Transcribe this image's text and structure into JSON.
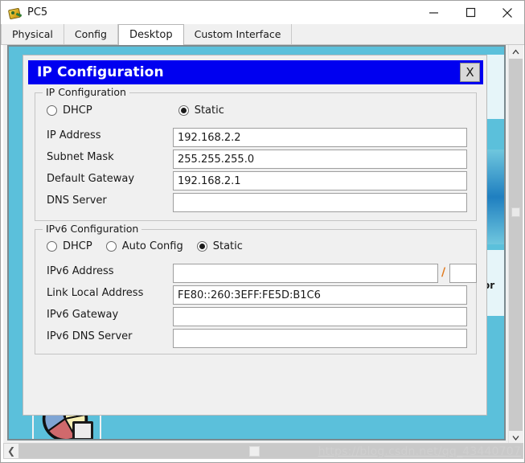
{
  "window": {
    "title": "PC5",
    "icon": "packet-tracer-device-icon",
    "controls": {
      "minimize": "–",
      "maximize": "□",
      "close": "✕"
    }
  },
  "tabs": [
    {
      "label": "Physical",
      "active": false
    },
    {
      "label": "Config",
      "active": false
    },
    {
      "label": "Desktop",
      "active": true
    },
    {
      "label": "Custom Interface",
      "active": false
    }
  ],
  "dialog": {
    "title": "IP Configuration",
    "close_label": "X",
    "ipv4": {
      "legend": "IP Configuration",
      "modes": [
        {
          "label": "DHCP",
          "selected": false
        },
        {
          "label": "Static",
          "selected": true
        }
      ],
      "fields": [
        {
          "label": "IP Address",
          "value": "192.168.2.2"
        },
        {
          "label": "Subnet Mask",
          "value": "255.255.255.0"
        },
        {
          "label": "Default Gateway",
          "value": "192.168.2.1"
        },
        {
          "label": "DNS Server",
          "value": ""
        }
      ]
    },
    "ipv6": {
      "legend": "IPv6 Configuration",
      "modes": [
        {
          "label": "DHCP",
          "selected": false
        },
        {
          "label": "Auto Config",
          "selected": false
        },
        {
          "label": "Static",
          "selected": true
        }
      ],
      "address": {
        "label": "IPv6 Address",
        "value": "",
        "separator": "/",
        "prefix": ""
      },
      "fields": [
        {
          "label": "Link Local Address",
          "value": "FE80::260:3EFF:FE5D:B1C6"
        },
        {
          "label": "IPv6 Gateway",
          "value": ""
        },
        {
          "label": "IPv6 DNS Server",
          "value": ""
        }
      ]
    }
  },
  "desktop": {
    "background_color": "#5bc0db",
    "icons": [
      {
        "name": "pie-chart-app-icon",
        "label": ""
      }
    ],
    "background_label": "or"
  },
  "scrollbars": {
    "vertical": {
      "up": "⌃",
      "down": "⌄"
    },
    "horizontal": {
      "left": "❮"
    }
  },
  "watermark": "https://blog.csdn.net/qq_43440707"
}
